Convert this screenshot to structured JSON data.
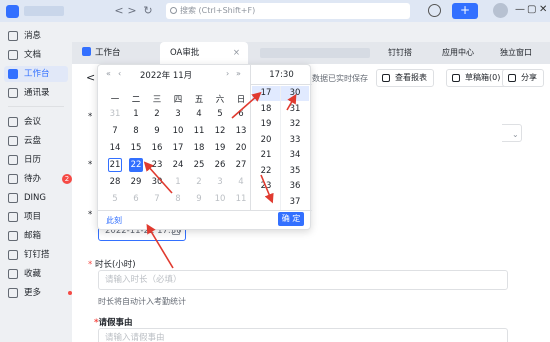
{
  "topbar": {
    "search_placeholder": "搜索 (Ctrl+Shift+F)",
    "back_glyph": "<",
    "forward_glyph": ">",
    "refresh_glyph": "↻",
    "plus_glyph": "+",
    "win_min": "—",
    "win_max": "▢",
    "win_close": "✕"
  },
  "sidebar": {
    "items": [
      {
        "label": "消息"
      },
      {
        "label": "文档"
      },
      {
        "label": "工作台"
      },
      {
        "label": "通讯录"
      },
      {
        "label": "会议"
      },
      {
        "label": "云盘"
      },
      {
        "label": "日历"
      },
      {
        "label": "待办",
        "badge": "2"
      },
      {
        "label": "DING"
      },
      {
        "label": "项目"
      },
      {
        "label": "邮箱"
      },
      {
        "label": "钉钉搭"
      },
      {
        "label": "收藏"
      },
      {
        "label": "更多"
      }
    ]
  },
  "tabs": {
    "items": [
      {
        "label": "工作台"
      },
      {
        "label": "OA审批",
        "close": "×"
      }
    ],
    "right": [
      {
        "label": "钉钉搭"
      },
      {
        "label": "应用中心"
      },
      {
        "label": "独立窗口"
      }
    ]
  },
  "main": {
    "back_glyph": "<",
    "saved_text": "数据已实时保存",
    "buttons": [
      {
        "label": "查看报表"
      },
      {
        "label": "草稿箱(0)"
      },
      {
        "label": "分享"
      }
    ],
    "datetime_value": "2022-11-22 17:30",
    "duration_label": "时长(小时)",
    "duration_placeholder": "请输入时长（必填）",
    "duration_hint": "时长将自动计入考勤统计",
    "reason_label": "请假事由",
    "reason_placeholder": "请输入请假事由",
    "required_mark": "*"
  },
  "picker": {
    "nav": {
      "prev_year": "«",
      "prev_month": "‹",
      "next_month": "›",
      "next_year": "»"
    },
    "title": "2022年  11月",
    "weekdays": [
      "一",
      "二",
      "三",
      "四",
      "五",
      "六",
      "日"
    ],
    "weeks": [
      [
        "31",
        "1",
        "2",
        "3",
        "4",
        "5",
        "6"
      ],
      [
        "7",
        "8",
        "9",
        "10",
        "11",
        "12",
        "13"
      ],
      [
        "14",
        "15",
        "16",
        "17",
        "18",
        "19",
        "20"
      ],
      [
        "21",
        "22",
        "23",
        "24",
        "25",
        "26",
        "27"
      ],
      [
        "28",
        "29",
        "30",
        "1",
        "2",
        "3",
        "4"
      ],
      [
        "5",
        "6",
        "7",
        "8",
        "9",
        "10",
        "11"
      ]
    ],
    "today": "21",
    "selected": "22",
    "time_title": "17:30",
    "hours": [
      "17",
      "18",
      "19",
      "20",
      "21",
      "22",
      "23"
    ],
    "minutes": [
      "30",
      "31",
      "32",
      "33",
      "34",
      "35",
      "36",
      "37"
    ],
    "selected_hour": "17",
    "selected_minute": "30",
    "now_label": "此刻",
    "ok_label": "确 定"
  }
}
